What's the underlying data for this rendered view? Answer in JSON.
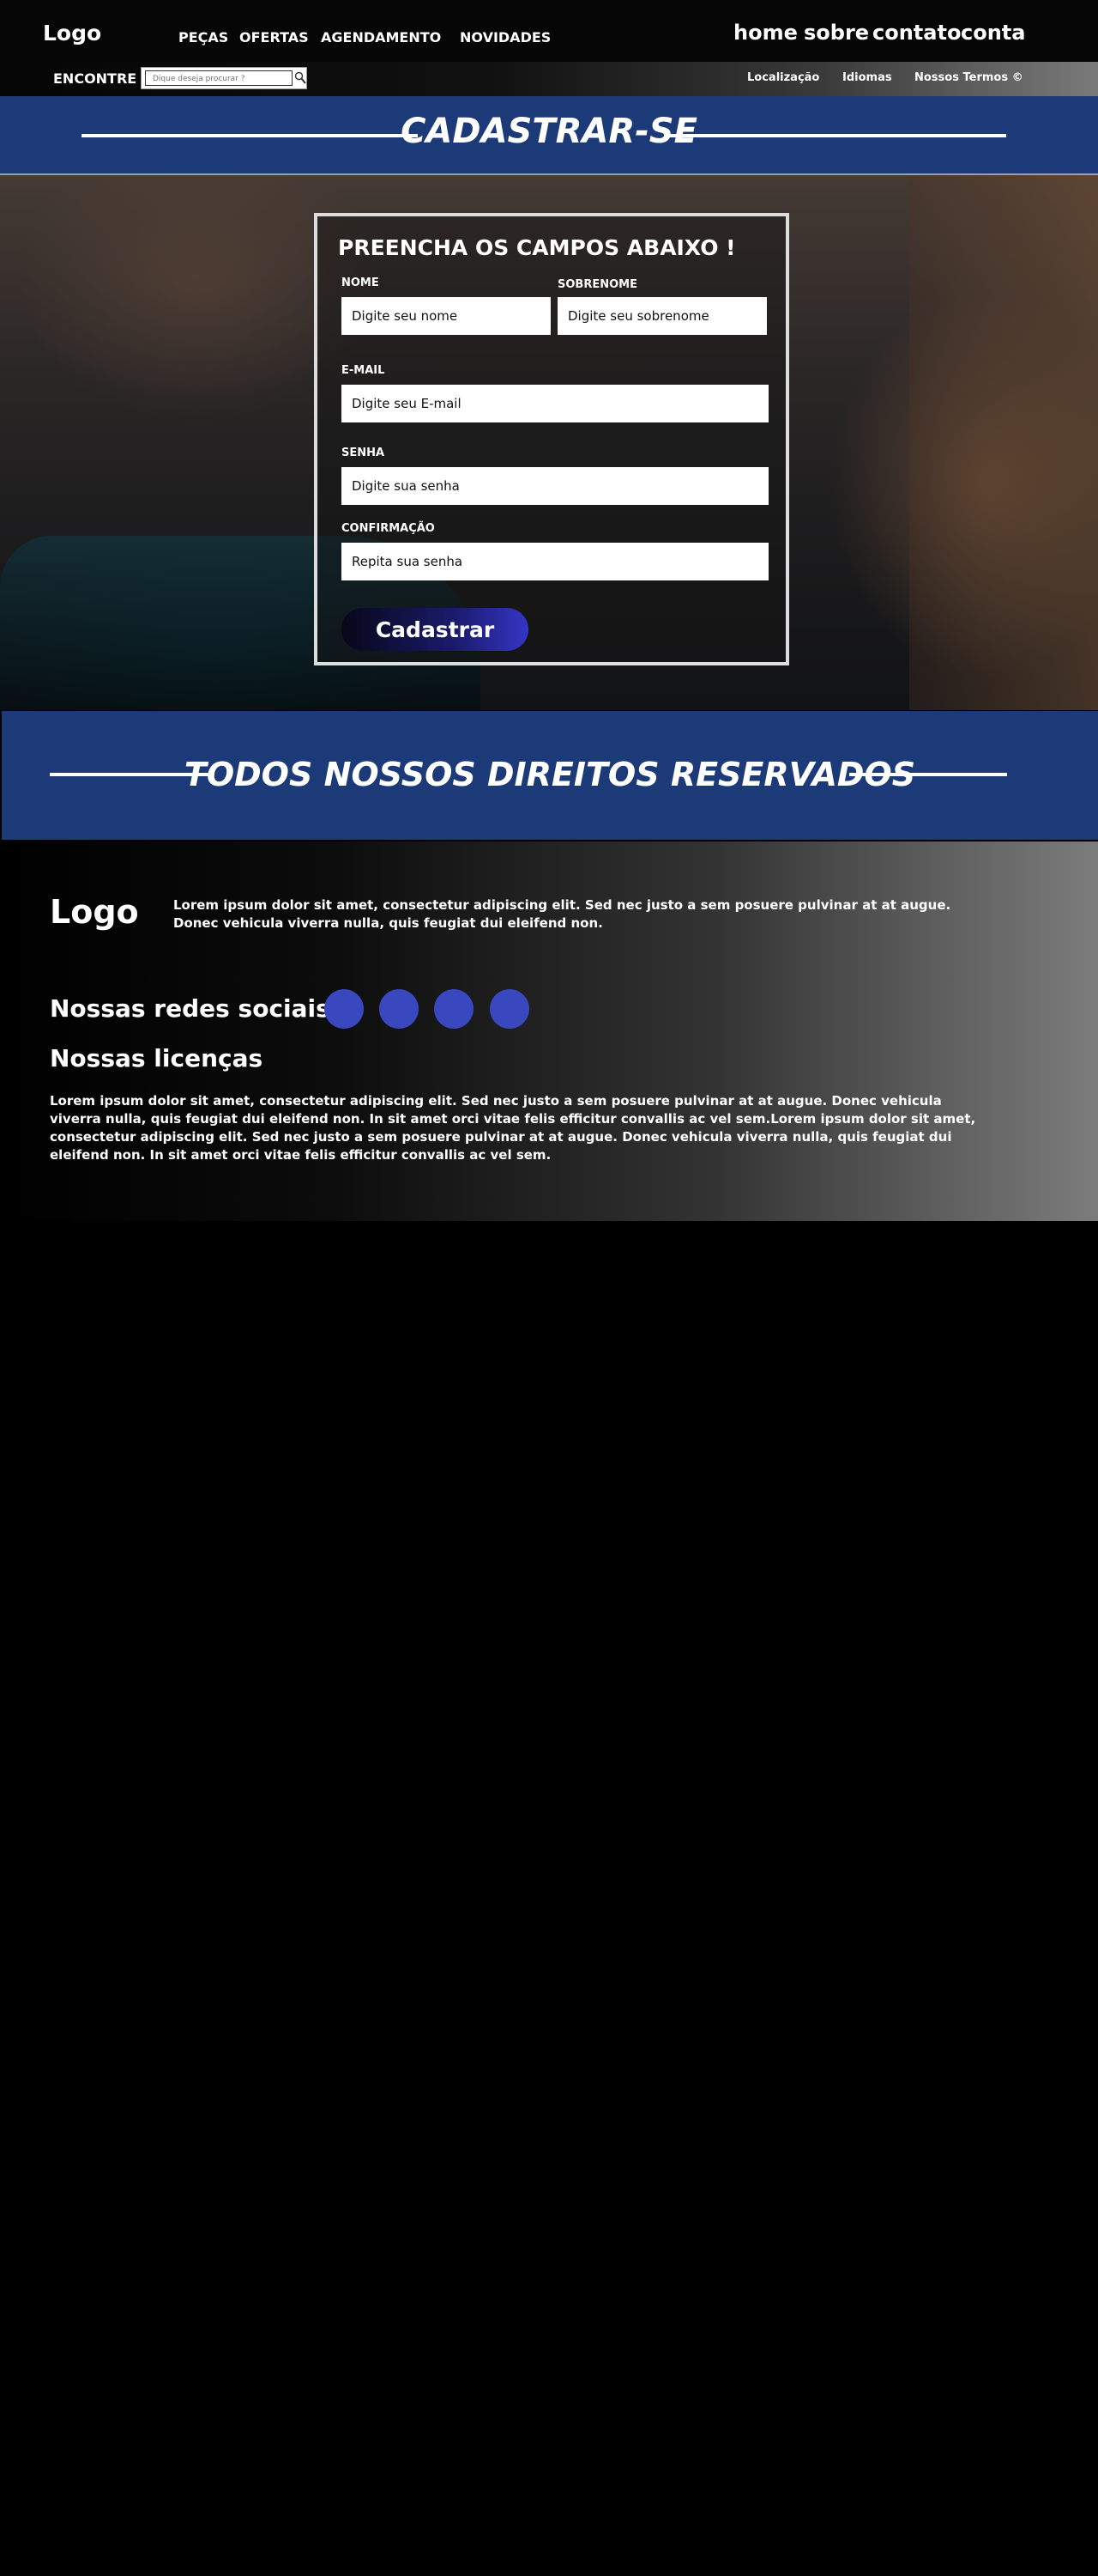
{
  "header": {
    "logo": "Logo",
    "nav_left": [
      "PEÇAS",
      "OFERTAS",
      "AGENDAMENTO",
      "NOVIDADES"
    ],
    "nav_right": [
      "home",
      "sobre",
      "contato",
      "conta"
    ]
  },
  "searchbar": {
    "label": "ENCONTRE",
    "placeholder": "Dique deseja procurar ?",
    "search_icon": "magnifier-icon",
    "links": [
      "Localização",
      "Idiomas",
      "Nossos Termos ©"
    ]
  },
  "register_banner": {
    "title": "CADASTRAR-SE"
  },
  "form": {
    "title": "PREENCHA OS CAMPOS ABAIXO !",
    "name_label": "NOME",
    "name_placeholder": "Digite seu nome",
    "surname_label": "SOBRENOME",
    "surname_placeholder": "Digite seu sobrenome",
    "email_label": "E-MAIL",
    "email_placeholder": "Digite seu E-mail",
    "password_label": "SENHA",
    "password_placeholder": "Digite sua senha",
    "confirm_label": "CONFIRMAÇÃO",
    "confirm_placeholder": "Repita sua senha",
    "submit_label": "Cadastrar"
  },
  "rights_banner": {
    "title": "TODOS NOSSOS DIREITOS RESERVADOS"
  },
  "footer": {
    "logo": "Logo",
    "description": "Lorem ipsum dolor sit amet, consectetur adipiscing elit. Sed nec justo a sem posuere pulvinar at at augue. Donec vehicula viverra nulla, quis feugiat dui eleifend non.",
    "social_title": "Nossas redes sociais",
    "social_icons": [
      "social-icon-1",
      "social-icon-2",
      "social-icon-3",
      "social-icon-4"
    ],
    "licenses_title": "Nossas licenças",
    "licenses_text": "Lorem ipsum dolor sit amet, consectetur adipiscing elit. Sed nec justo a sem posuere pulvinar at at augue. Donec vehicula viverra nulla, quis feugiat dui eleifend non. In sit amet orci vitae felis efficitur convallis ac vel sem.Lorem ipsum dolor sit amet, consectetur adipiscing elit. Sed nec justo a sem posuere pulvinar at at augue. Donec vehicula viverra nulla, quis feugiat dui eleifend non. In sit amet orci vitae felis efficitur convallis ac vel sem."
  },
  "colors": {
    "banner_blue": "#1c3a78",
    "social_blue": "#3a48c0",
    "button_gradient_end": "#3535c8"
  }
}
